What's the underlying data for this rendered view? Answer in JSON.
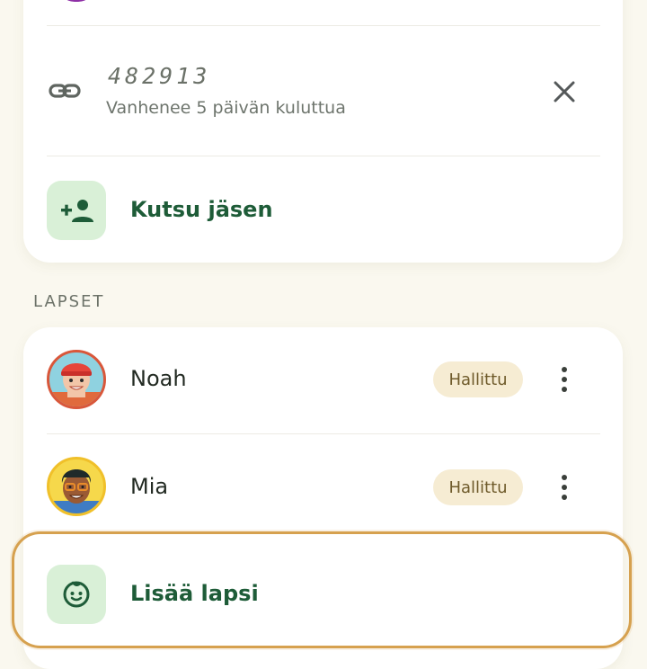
{
  "invite": {
    "code": "482913",
    "expiry": "Vanhenee 5 päivän kuluttua",
    "icon": "link-icon",
    "close_icon": "close-icon"
  },
  "invite_member": {
    "label": "Kutsu jäsen",
    "icon": "person-add-icon"
  },
  "children_section": {
    "header": "LAPSET",
    "children": [
      {
        "name": "Noah",
        "badge": "Hallittu",
        "avatar": "avatar-noah"
      },
      {
        "name": "Mia",
        "badge": "Hallittu",
        "avatar": "avatar-mia"
      }
    ]
  },
  "add_child": {
    "label": "Lisää lapsi",
    "icon": "child-face-icon"
  },
  "colors": {
    "background": "#faf8ef",
    "card": "#ffffff",
    "accent_green": "#1e5c38",
    "tile_green": "#d9f0d7",
    "badge_bg": "#f6ecd3",
    "highlight": "#d6a14f"
  }
}
